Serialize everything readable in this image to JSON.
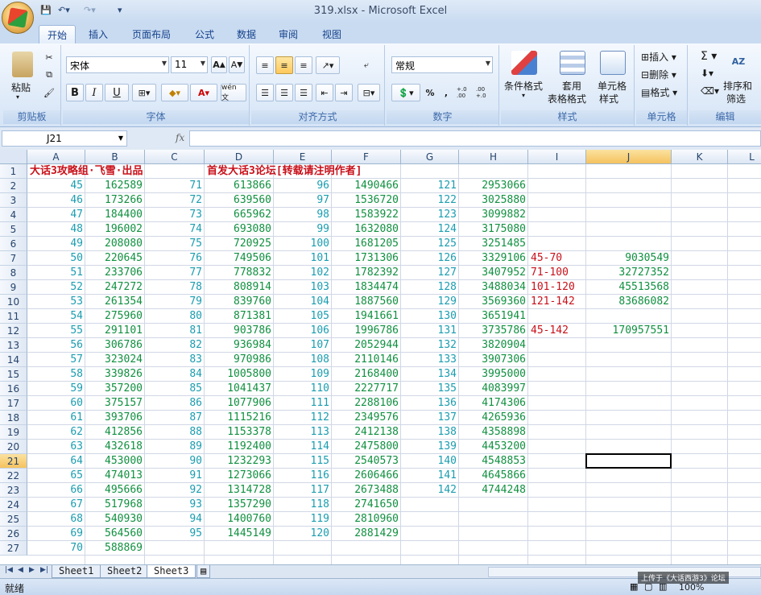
{
  "window": {
    "title": "319.xlsx - Microsoft Excel"
  },
  "tabs": [
    "开始",
    "插入",
    "页面布局",
    "公式",
    "数据",
    "审阅",
    "视图"
  ],
  "ribbon": {
    "clipboard": {
      "label": "剪贴板",
      "paste": "粘贴"
    },
    "font": {
      "label": "字体",
      "name": "宋体",
      "size": "11",
      "bold": "B",
      "italic": "I",
      "underline": "U",
      "fontcolor_glyph": "A",
      "phonetic": "wén 文"
    },
    "alignment": {
      "label": "对齐方式"
    },
    "number": {
      "label": "数字",
      "format": "常规",
      "percent": "%",
      "comma": ",",
      "inc_decimal": "+.0 .00",
      "dec_decimal": ".00 +.0"
    },
    "styles": {
      "label": "样式",
      "conditional": "条件格式",
      "table_line1": "套用",
      "table_line2": "表格格式",
      "cell_line1": "单元格",
      "cell_line2": "样式"
    },
    "cells": {
      "label": "单元格",
      "insert": "插入",
      "delete": "删除",
      "format": "格式"
    },
    "editing": {
      "label": "编辑",
      "sigma": "Σ",
      "sort_line1": "排序和",
      "sort_line2": "筛选"
    }
  },
  "formula_bar": {
    "name_box": "J21",
    "fx": "fx",
    "content": ""
  },
  "columns": [
    "A",
    "B",
    "C",
    "D",
    "E",
    "F",
    "G",
    "H",
    "I",
    "J",
    "K",
    "L"
  ],
  "rows": [
    "1",
    "2",
    "3",
    "4",
    "5",
    "6",
    "7",
    "8",
    "9",
    "10",
    "11",
    "12",
    "13",
    "14",
    "15",
    "16",
    "17",
    "18",
    "19",
    "20",
    "21",
    "22",
    "23",
    "24",
    "25",
    "26",
    "27"
  ],
  "sheet": {
    "row1": {
      "a": "大话3攻略组·飞雪·出品",
      "d": "首发大话3论坛[转载请注明作者]"
    },
    "colA": [
      "45",
      "46",
      "47",
      "48",
      "49",
      "50",
      "51",
      "52",
      "53",
      "54",
      "55",
      "56",
      "57",
      "58",
      "59",
      "60",
      "61",
      "62",
      "63",
      "64",
      "65",
      "66",
      "67",
      "68",
      "69",
      "70"
    ],
    "colB": [
      "162589",
      "173266",
      "184400",
      "196002",
      "208080",
      "220645",
      "233706",
      "247272",
      "261354",
      "275960",
      "291101",
      "306786",
      "323024",
      "339826",
      "357200",
      "375157",
      "393706",
      "412856",
      "432618",
      "453000",
      "474013",
      "495666",
      "517968",
      "540930",
      "564560",
      "588869"
    ],
    "colC": [
      "71",
      "72",
      "73",
      "74",
      "75",
      "76",
      "77",
      "78",
      "79",
      "80",
      "81",
      "82",
      "83",
      "84",
      "85",
      "86",
      "87",
      "88",
      "89",
      "90",
      "91",
      "92",
      "93",
      "94",
      "95"
    ],
    "colD": [
      "613866",
      "639560",
      "665962",
      "693080",
      "720925",
      "749506",
      "778832",
      "808914",
      "839760",
      "871381",
      "903786",
      "936984",
      "970986",
      "1005800",
      "1041437",
      "1077906",
      "1115216",
      "1153378",
      "1192400",
      "1232293",
      "1273066",
      "1314728",
      "1357290",
      "1400760",
      "1445149"
    ],
    "colE": [
      "96",
      "97",
      "98",
      "99",
      "100",
      "101",
      "102",
      "103",
      "104",
      "105",
      "106",
      "107",
      "108",
      "109",
      "110",
      "111",
      "112",
      "113",
      "114",
      "115",
      "116",
      "117",
      "118",
      "119",
      "120"
    ],
    "colF": [
      "1490466",
      "1536720",
      "1583922",
      "1632080",
      "1681205",
      "1731306",
      "1782392",
      "1834474",
      "1887560",
      "1941661",
      "1996786",
      "2052944",
      "2110146",
      "2168400",
      "2227717",
      "2288106",
      "2349576",
      "2412138",
      "2475800",
      "2540573",
      "2606466",
      "2673488",
      "2741650",
      "2810960",
      "2881429"
    ],
    "colG": [
      "121",
      "122",
      "123",
      "124",
      "125",
      "126",
      "127",
      "128",
      "129",
      "130",
      "131",
      "132",
      "133",
      "134",
      "135",
      "136",
      "137",
      "138",
      "139",
      "140",
      "141",
      "142"
    ],
    "colH": [
      "2953066",
      "3025880",
      "3099882",
      "3175080",
      "3251485",
      "3329106",
      "3407952",
      "3488034",
      "3569360",
      "3651941",
      "3735786",
      "3820904",
      "3907306",
      "3995000",
      "4083997",
      "4174306",
      "4265936",
      "4358898",
      "4453200",
      "4548853",
      "4645866",
      "4744248"
    ],
    "summary": [
      {
        "row": 7,
        "label": "45-70",
        "value": "9030549"
      },
      {
        "row": 8,
        "label": "71-100",
        "value": "32727352"
      },
      {
        "row": 9,
        "label": "101-120",
        "value": "45513568"
      },
      {
        "row": 10,
        "label": "121-142",
        "value": "83686082"
      },
      {
        "row": 12,
        "label": "45-142",
        "value": "170957551"
      }
    ]
  },
  "sheet_tabs": [
    "Sheet1",
    "Sheet2",
    "Sheet3"
  ],
  "active_sheet": "Sheet3",
  "status": {
    "text": "就绪",
    "zoom": "100%"
  },
  "watermark": "上传于《大话西游3》论坛",
  "colors": {
    "teal": "#1a9db0",
    "green": "#109040",
    "red": "#c8101a",
    "selected_header": "#f5c25e"
  }
}
